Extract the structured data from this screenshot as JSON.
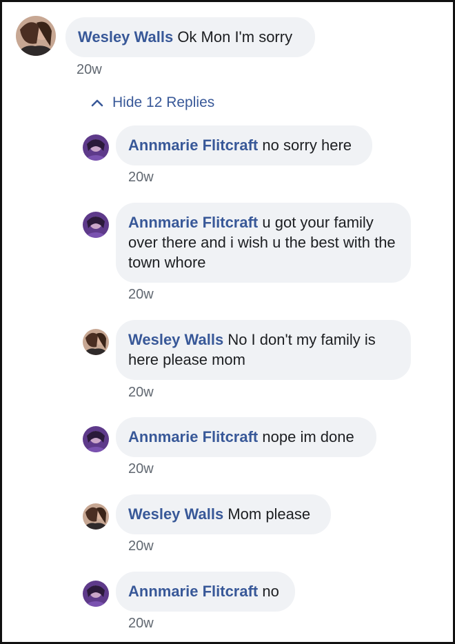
{
  "top_comment": {
    "author": "Wesley Walls",
    "text": "Ok Mon I'm sorry",
    "time": "20w"
  },
  "replies_toggle": {
    "label": "Hide 12 Replies",
    "icon": "chevron-up-icon"
  },
  "replies": [
    {
      "author": "Annmarie Flitcraft",
      "text": "no sorry here",
      "time": "20w"
    },
    {
      "author": "Annmarie Flitcraft",
      "text": "u got your family over there and i wish u the best with the town whore",
      "time": "20w"
    },
    {
      "author": "Wesley Walls",
      "text": "No I don't my family is here please mom",
      "time": "20w"
    },
    {
      "author": "Annmarie Flitcraft",
      "text": "nope im done",
      "time": "20w"
    },
    {
      "author": "Wesley Walls",
      "text": "Mom please",
      "time": "20w"
    },
    {
      "author": "Annmarie Flitcraft",
      "text": "no",
      "time": "20w"
    }
  ],
  "colors": {
    "link": "#385898",
    "bubble": "#f0f2f5",
    "meta": "#606770"
  }
}
